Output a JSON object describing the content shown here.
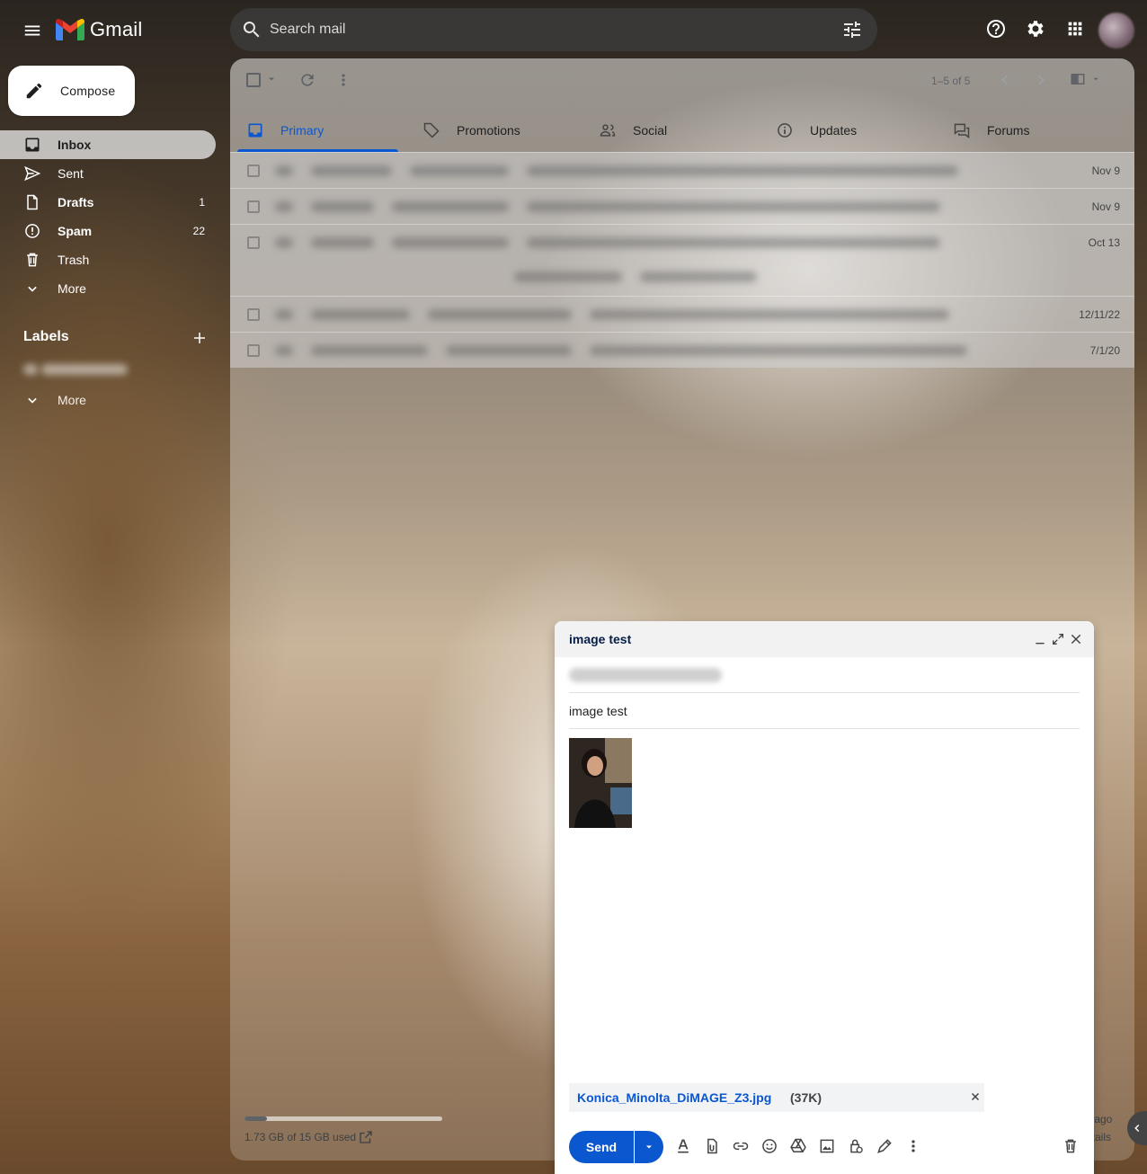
{
  "app": {
    "brand": "Gmail",
    "accent": "#0b57d0"
  },
  "search": {
    "placeholder": "Search mail"
  },
  "sidebar": {
    "compose_label": "Compose",
    "items": [
      {
        "label": "Inbox",
        "count": "",
        "icon": "inbox-icon"
      },
      {
        "label": "Sent",
        "count": "",
        "icon": "send-icon"
      },
      {
        "label": "Drafts",
        "count": "1",
        "icon": "draft-icon"
      },
      {
        "label": "Spam",
        "count": "22",
        "icon": "spam-icon"
      },
      {
        "label": "Trash",
        "count": "",
        "icon": "trash-icon"
      },
      {
        "label": "More",
        "count": "",
        "icon": "chevron-down-icon"
      }
    ],
    "labels_heading": "Labels",
    "labels_more": "More"
  },
  "toolbar": {
    "pager": "1–5 of 5"
  },
  "tabs": [
    {
      "label": "Primary",
      "icon": "inbox-icon"
    },
    {
      "label": "Promotions",
      "icon": "tag-icon"
    },
    {
      "label": "Social",
      "icon": "people-icon"
    },
    {
      "label": "Updates",
      "icon": "info-icon"
    },
    {
      "label": "Forums",
      "icon": "forum-icon"
    }
  ],
  "messages": [
    {
      "date": "Nov 9"
    },
    {
      "date": "Nov 9"
    },
    {
      "date": "Oct 13"
    },
    {
      "date": "12/11/22"
    },
    {
      "date": "7/1/20"
    }
  ],
  "storage": {
    "text": "1.73 GB of 15 GB used",
    "used_fraction": 0.115
  },
  "activity": {
    "line1": "s ago",
    "line2": "etails"
  },
  "compose_window": {
    "title": "image test",
    "subject": "image test",
    "attachment_name": "Konica_Minolta_DiMAGE_Z3.jpg",
    "attachment_size": "(37K)",
    "send_label": "Send"
  }
}
